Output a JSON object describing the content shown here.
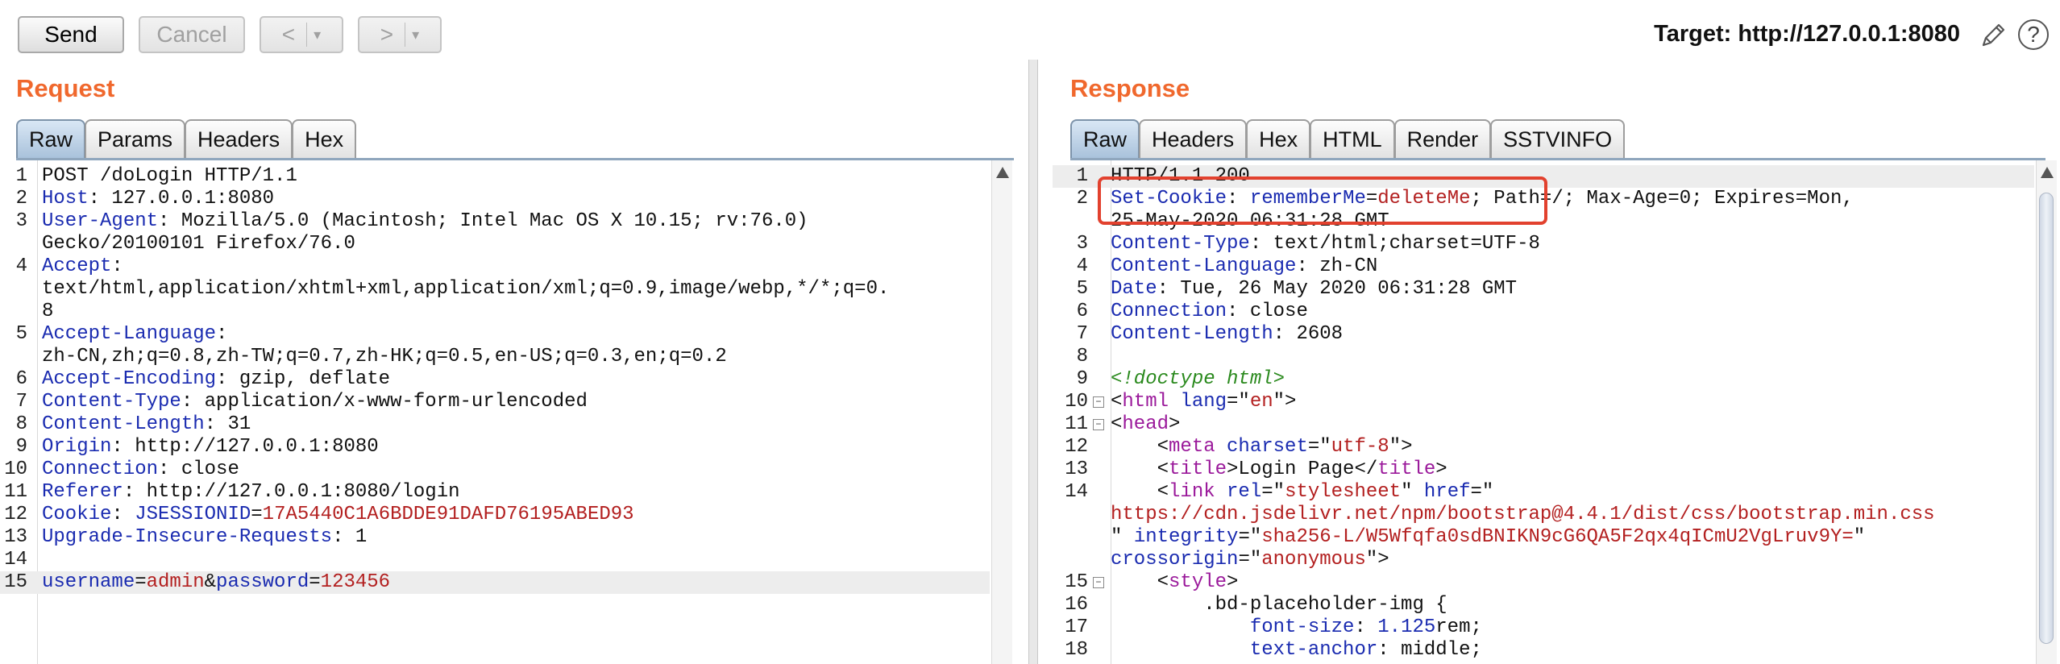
{
  "toolbar": {
    "send_label": "Send",
    "cancel_label": "Cancel",
    "back_label": "<",
    "forward_label": ">",
    "dropdown_glyph": "▾",
    "target_label": "Target: http://127.0.0.1:8080",
    "help_glyph": "?"
  },
  "request": {
    "title": "Request",
    "tabs": [
      "Raw",
      "Params",
      "Headers",
      "Hex"
    ],
    "active_tab": "Raw",
    "lines": [
      {
        "n": "1",
        "parts": [
          {
            "t": "POST /doLogin HTTP/1.1",
            "c": "plain"
          }
        ]
      },
      {
        "n": "2",
        "parts": [
          {
            "t": "Host",
            "c": "hkey"
          },
          {
            "t": ": 127.0.0.1:8080",
            "c": "hval"
          }
        ]
      },
      {
        "n": "3",
        "parts": [
          {
            "t": "User-Agent",
            "c": "hkey"
          },
          {
            "t": ": Mozilla/5.0 (Macintosh; Intel Mac OS X 10.15; rv:76.0)",
            "c": "hval"
          }
        ]
      },
      {
        "n": "",
        "parts": [
          {
            "t": "Gecko/20100101 Firefox/76.0",
            "c": "hval"
          }
        ]
      },
      {
        "n": "4",
        "parts": [
          {
            "t": "Accept",
            "c": "hkey"
          },
          {
            "t": ":",
            "c": "hval"
          }
        ]
      },
      {
        "n": "",
        "parts": [
          {
            "t": "text/html,application/xhtml+xml,application/xml;q=0.9,image/webp,*/*;q=0.",
            "c": "hval"
          }
        ]
      },
      {
        "n": "",
        "parts": [
          {
            "t": "8",
            "c": "hval"
          }
        ]
      },
      {
        "n": "5",
        "parts": [
          {
            "t": "Accept-Language",
            "c": "hkey"
          },
          {
            "t": ":",
            "c": "hval"
          }
        ]
      },
      {
        "n": "",
        "parts": [
          {
            "t": "zh-CN,zh;q=0.8,zh-TW;q=0.7,zh-HK;q=0.5,en-US;q=0.3,en;q=0.2",
            "c": "hval"
          }
        ]
      },
      {
        "n": "6",
        "parts": [
          {
            "t": "Accept-Encoding",
            "c": "hkey"
          },
          {
            "t": ": gzip, deflate",
            "c": "hval"
          }
        ]
      },
      {
        "n": "7",
        "parts": [
          {
            "t": "Content-Type",
            "c": "hkey"
          },
          {
            "t": ": application/x-www-form-urlencoded",
            "c": "hval"
          }
        ]
      },
      {
        "n": "8",
        "parts": [
          {
            "t": "Content-Length",
            "c": "hkey"
          },
          {
            "t": ": 31",
            "c": "hval"
          }
        ]
      },
      {
        "n": "9",
        "parts": [
          {
            "t": "Origin",
            "c": "hkey"
          },
          {
            "t": ": http://127.0.0.1:8080",
            "c": "hval"
          }
        ]
      },
      {
        "n": "10",
        "parts": [
          {
            "t": "Connection",
            "c": "hkey"
          },
          {
            "t": ": close",
            "c": "hval"
          }
        ]
      },
      {
        "n": "11",
        "parts": [
          {
            "t": "Referer",
            "c": "hkey"
          },
          {
            "t": ": http://127.0.0.1:8080/login",
            "c": "hval"
          }
        ]
      },
      {
        "n": "12",
        "parts": [
          {
            "t": "Cookie",
            "c": "hkey"
          },
          {
            "t": ": ",
            "c": "hval"
          },
          {
            "t": "JSESSIONID",
            "c": "pname"
          },
          {
            "t": "=",
            "c": "hval"
          },
          {
            "t": "17A5440C1A6BDDE91DAFD76195ABED93",
            "c": "pval"
          }
        ]
      },
      {
        "n": "13",
        "parts": [
          {
            "t": "Upgrade-Insecure-Requests",
            "c": "hkey"
          },
          {
            "t": ": 1",
            "c": "hval"
          }
        ]
      },
      {
        "n": "14",
        "parts": []
      },
      {
        "n": "15",
        "hl": true,
        "parts": [
          {
            "t": "username",
            "c": "pname"
          },
          {
            "t": "=",
            "c": "hval"
          },
          {
            "t": "admin",
            "c": "pval"
          },
          {
            "t": "&",
            "c": "hval"
          },
          {
            "t": "password",
            "c": "pname"
          },
          {
            "t": "=",
            "c": "hval"
          },
          {
            "t": "123456",
            "c": "pval"
          }
        ]
      }
    ]
  },
  "response": {
    "title": "Response",
    "tabs": [
      "Raw",
      "Headers",
      "Hex",
      "HTML",
      "Render",
      "SSTVINFO"
    ],
    "active_tab": "Raw",
    "lines": [
      {
        "n": "1",
        "hl": true,
        "parts": [
          {
            "t": "HTTP/1.1 200",
            "c": "plain"
          }
        ]
      },
      {
        "n": "2",
        "parts": [
          {
            "t": "Set-Cookie",
            "c": "hkey"
          },
          {
            "t": ": ",
            "c": "hval"
          },
          {
            "t": "rememberMe",
            "c": "pname"
          },
          {
            "t": "=",
            "c": "hval"
          },
          {
            "t": "deleteMe",
            "c": "pval"
          },
          {
            "t": "; Path=/; Max-Age=0; Expires=Mon,",
            "c": "hval"
          }
        ]
      },
      {
        "n": "",
        "parts": [
          {
            "t": "25-May-2020 06:31:28 GMT",
            "c": "hval"
          }
        ]
      },
      {
        "n": "3",
        "parts": [
          {
            "t": "Content-Type",
            "c": "hkey"
          },
          {
            "t": ": text/html;charset=UTF-8",
            "c": "hval"
          }
        ]
      },
      {
        "n": "4",
        "parts": [
          {
            "t": "Content-Language",
            "c": "hkey"
          },
          {
            "t": ": zh-CN",
            "c": "hval"
          }
        ]
      },
      {
        "n": "5",
        "parts": [
          {
            "t": "Date",
            "c": "hkey"
          },
          {
            "t": ": Tue, 26 May 2020 06:31:28 GMT",
            "c": "hval"
          }
        ]
      },
      {
        "n": "6",
        "parts": [
          {
            "t": "Connection",
            "c": "hkey"
          },
          {
            "t": ": close",
            "c": "hval"
          }
        ]
      },
      {
        "n": "7",
        "parts": [
          {
            "t": "Content-Length",
            "c": "hkey"
          },
          {
            "t": ": 2608",
            "c": "hval"
          }
        ]
      },
      {
        "n": "8",
        "parts": []
      },
      {
        "n": "9",
        "parts": [
          {
            "t": "<!doctype html>",
            "c": "comment"
          }
        ]
      },
      {
        "n": "10",
        "fold": "−",
        "parts": [
          {
            "t": "<",
            "c": "plain"
          },
          {
            "t": "html",
            "c": "tag"
          },
          {
            "t": " ",
            "c": "plain"
          },
          {
            "t": "lang",
            "c": "attr"
          },
          {
            "t": "=\"",
            "c": "plain"
          },
          {
            "t": "en",
            "c": "aval"
          },
          {
            "t": "\">",
            "c": "plain"
          }
        ]
      },
      {
        "n": "11",
        "fold": "−",
        "parts": [
          {
            "t": "<",
            "c": "plain"
          },
          {
            "t": "head",
            "c": "tag"
          },
          {
            "t": ">",
            "c": "plain"
          }
        ]
      },
      {
        "n": "12",
        "parts": [
          {
            "t": "    <",
            "c": "plain"
          },
          {
            "t": "meta",
            "c": "tag"
          },
          {
            "t": " ",
            "c": "plain"
          },
          {
            "t": "charset",
            "c": "attr"
          },
          {
            "t": "=\"",
            "c": "plain"
          },
          {
            "t": "utf-8",
            "c": "aval"
          },
          {
            "t": "\">",
            "c": "plain"
          }
        ]
      },
      {
        "n": "13",
        "parts": [
          {
            "t": "    <",
            "c": "plain"
          },
          {
            "t": "title",
            "c": "tag"
          },
          {
            "t": ">Login Page</",
            "c": "plain"
          },
          {
            "t": "title",
            "c": "tag"
          },
          {
            "t": ">",
            "c": "plain"
          }
        ]
      },
      {
        "n": "14",
        "parts": [
          {
            "t": "    <",
            "c": "plain"
          },
          {
            "t": "link",
            "c": "tag"
          },
          {
            "t": " ",
            "c": "plain"
          },
          {
            "t": "rel",
            "c": "attr"
          },
          {
            "t": "=\"",
            "c": "plain"
          },
          {
            "t": "stylesheet",
            "c": "aval"
          },
          {
            "t": "\" ",
            "c": "plain"
          },
          {
            "t": "href",
            "c": "attr"
          },
          {
            "t": "=\"",
            "c": "plain"
          }
        ]
      },
      {
        "n": "",
        "parts": [
          {
            "t": "https://cdn.jsdelivr.net/npm/bootstrap@4.4.1/dist/css/bootstrap.min.css",
            "c": "aval"
          }
        ]
      },
      {
        "n": "",
        "parts": [
          {
            "t": "\" ",
            "c": "plain"
          },
          {
            "t": "integrity",
            "c": "attr"
          },
          {
            "t": "=\"",
            "c": "plain"
          },
          {
            "t": "sha256-L/W5Wfqfa0sdBNIKN9cG6QA5F2qx4qICmU2VgLruv9Y=",
            "c": "aval"
          },
          {
            "t": "\"",
            "c": "plain"
          }
        ]
      },
      {
        "n": "",
        "parts": [
          {
            "t": "crossorigin",
            "c": "attr"
          },
          {
            "t": "=\"",
            "c": "plain"
          },
          {
            "t": "anonymous",
            "c": "aval"
          },
          {
            "t": "\">",
            "c": "plain"
          }
        ]
      },
      {
        "n": "15",
        "fold": "−",
        "parts": [
          {
            "t": "    <",
            "c": "plain"
          },
          {
            "t": "style",
            "c": "tag"
          },
          {
            "t": ">",
            "c": "plain"
          }
        ]
      },
      {
        "n": "16",
        "parts": [
          {
            "t": "        .bd-placeholder-img {",
            "c": "plain"
          }
        ]
      },
      {
        "n": "17",
        "parts": [
          {
            "t": "            ",
            "c": "plain"
          },
          {
            "t": "font-size",
            "c": "attr"
          },
          {
            "t": ": ",
            "c": "plain"
          },
          {
            "t": "1.125",
            "c": "num-lit"
          },
          {
            "t": "rem;",
            "c": "plain"
          }
        ]
      },
      {
        "n": "18",
        "parts": [
          {
            "t": "            ",
            "c": "plain"
          },
          {
            "t": "text-anchor",
            "c": "attr"
          },
          {
            "t": ": middle;",
            "c": "plain"
          }
        ]
      }
    ]
  },
  "colors": {
    "accent_orange": "#f0682d",
    "highlight_box": "#e2412e",
    "header_key": "#1a2bb0",
    "param_value": "#b32020"
  }
}
